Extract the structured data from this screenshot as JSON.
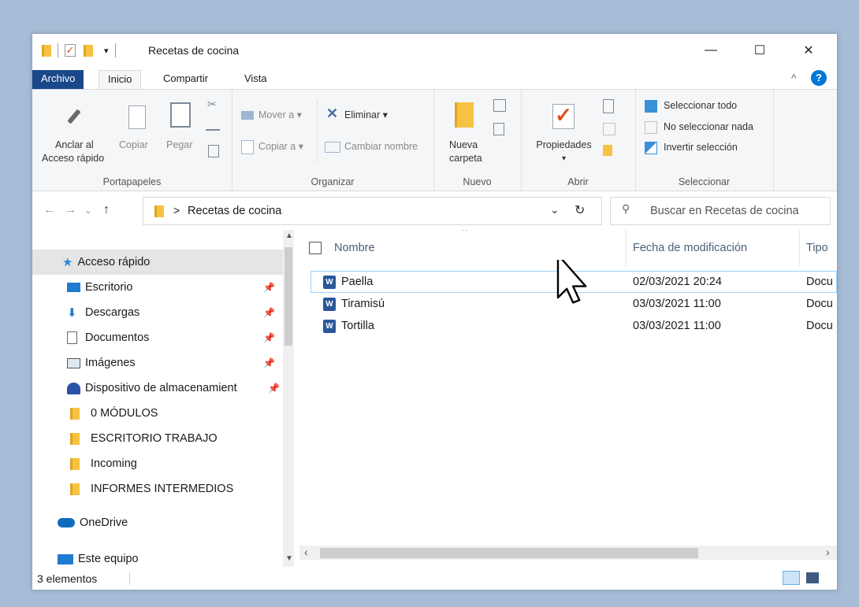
{
  "window": {
    "title": "Recetas de cocina",
    "minimize": "—",
    "maximize": "☐",
    "close": "✕"
  },
  "menu": {
    "tabs": [
      "Archivo",
      "Inicio",
      "Compartir",
      "Vista"
    ],
    "help": "?",
    "collapse": "^"
  },
  "ribbon": {
    "portapapeles": {
      "pin_label_1": "Anclar al",
      "pin_label_2": "Acceso rápido",
      "copy": "Copiar",
      "paste": "Pegar",
      "group": "Portapapeles"
    },
    "organizar": {
      "move": "Mover a ▾",
      "copy_to": "Copiar a ▾",
      "delete": "Eliminar ▾",
      "rename": "Cambiar nombre",
      "group": "Organizar"
    },
    "nuevo": {
      "new_folder_1": "Nueva",
      "new_folder_2": "carpeta",
      "group": "Nuevo"
    },
    "abrir": {
      "properties": "Propiedades",
      "arrow": "▾",
      "group": "Abrir"
    },
    "seleccionar": {
      "select_all": "Seleccionar todo",
      "select_none": "No seleccionar nada",
      "invert": "Invertir selección",
      "group": "Seleccionar"
    }
  },
  "address": {
    "separator": ">",
    "path": "Recetas de cocina",
    "dropdown": "⌄",
    "refresh": "↻",
    "search_placeholder": "Buscar en Recetas de cocina",
    "back": "←",
    "forward": "→",
    "recent": "⌄",
    "up": "↑"
  },
  "nav": {
    "items": [
      {
        "label": "Acceso rápido",
        "pinned": false
      },
      {
        "label": "Escritorio",
        "pinned": true
      },
      {
        "label": "Descargas",
        "pinned": true
      },
      {
        "label": "Documentos",
        "pinned": true
      },
      {
        "label": "Imágenes",
        "pinned": true
      },
      {
        "label": "Dispositivo de almacenamient",
        "pinned": true
      },
      {
        "label": "0 MÓDULOS",
        "pinned": false
      },
      {
        "label": "ESCRITORIO TRABAJO",
        "pinned": false
      },
      {
        "label": "Incoming",
        "pinned": false
      },
      {
        "label": "INFORMES INTERMEDIOS",
        "pinned": false
      },
      {
        "label": "OneDrive",
        "pinned": false
      },
      {
        "label": "Este equipo",
        "pinned": false
      }
    ]
  },
  "columns": {
    "name": "Nombre",
    "date": "Fecha de modificación",
    "type": "Tipo"
  },
  "files": [
    {
      "name": "Paella",
      "date": "02/03/2021 20:24",
      "type": "Docu"
    },
    {
      "name": "Tiramisú",
      "date": "03/03/2021 11:00",
      "type": "Docu"
    },
    {
      "name": "Tortilla",
      "date": "03/03/2021 11:00",
      "type": "Docu"
    }
  ],
  "status": {
    "count": "3 elementos"
  },
  "colors": {
    "file_tab": "#19478a",
    "accent": "#0078d7",
    "hover_border": "#99d1ff"
  }
}
